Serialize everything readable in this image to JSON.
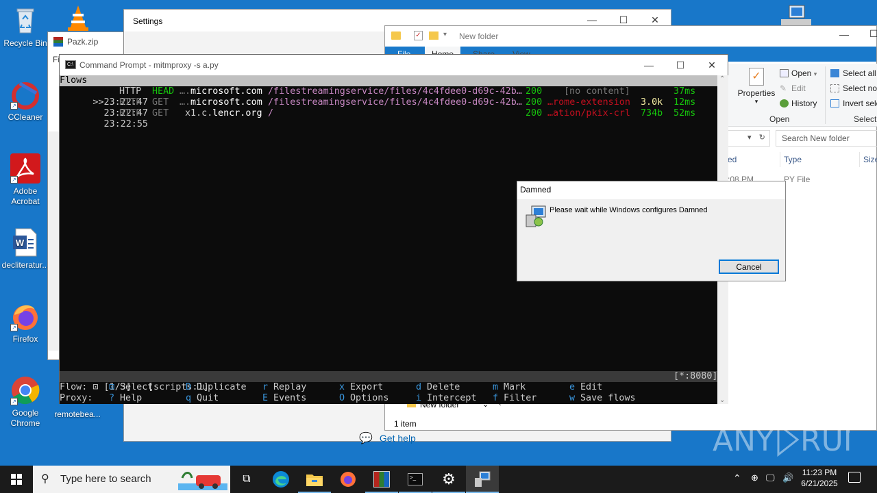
{
  "desktop": {
    "icons": [
      {
        "label": "Recycle Bin"
      },
      {
        "label": "CCleaner"
      },
      {
        "label": "Adobe Acrobat"
      },
      {
        "label": "decliteratur..."
      },
      {
        "label": "Firefox"
      },
      {
        "label": "Google Chrome"
      },
      {
        "label": "remotebea..."
      }
    ],
    "watermark": "ANY RUN"
  },
  "settings_window": {
    "title": "Settings",
    "get_help": "Get help"
  },
  "pazk_window": {
    "title": "Pazk.zip",
    "partial_menu": "Fi"
  },
  "explorer": {
    "title": "New folder",
    "tabs": [
      "File",
      "Home",
      "Share",
      "View"
    ],
    "ribbon": {
      "properties": "Properties",
      "open": "Open",
      "edit": "Edit",
      "history": "History",
      "open_group": "Open",
      "select_all": "Select all",
      "select_none": "Select nor",
      "invert_selection": "Invert sele",
      "select_group": "Select"
    },
    "search_placeholder": "Search New folder",
    "columns": {
      "modified": "ed",
      "type": "Type",
      "size": "Size"
    },
    "row": {
      "modified": ":08 PM",
      "type": "PY File"
    },
    "nav_folder": "New folder",
    "status": "1 item"
  },
  "cmd": {
    "title": "Command Prompt - mitmproxy  -s a.py",
    "header": "Flows",
    "flows": [
      {
        "marker": ">>",
        "time": "23:22:47",
        "proto": "HTTP",
        "method": "HEAD",
        "host_prefix": "….",
        "host": "microsoft.com",
        "path": "/filestreamingservice/files/4c4fdee0-d69c-42b…",
        "status": "200",
        "content": "[no content]",
        "size": "",
        "duration": "37ms"
      },
      {
        "marker": "  ",
        "time": "23:22:47",
        "proto": "HTTP",
        "method": "GET",
        "host_prefix": "….",
        "host": "microsoft.com",
        "path": "/filestreamingservice/files/4c4fdee0-d69c-42b…",
        "status": "200",
        "content": "…rome-extension",
        "size": "3.0k",
        "duration": "12ms"
      },
      {
        "marker": "  ",
        "time": "23:22:55",
        "proto": "HTTP",
        "method": "GET",
        "host_prefix": "x1.c.",
        "host": "lencr.org",
        "path": "/",
        "status": "200",
        "content": "…ation/pkix-crl",
        "size": "734b",
        "duration": "52ms"
      }
    ],
    "statusbar_left": "⊡ [1/3]   [scripts:1]",
    "statusbar_right": "[*:8080]",
    "keys_row1_label": "Flow:",
    "keys_row2_label": "Proxy:",
    "keys_row1": [
      {
        "key": "⊡",
        "label": "Select"
      },
      {
        "key": "D",
        "label": "Duplicate"
      },
      {
        "key": "r",
        "label": "Replay"
      },
      {
        "key": "x",
        "label": "Export"
      },
      {
        "key": "d",
        "label": "Delete"
      },
      {
        "key": "m",
        "label": "Mark"
      },
      {
        "key": "e",
        "label": "Edit"
      }
    ],
    "keys_row2": [
      {
        "key": "?",
        "label": "Help"
      },
      {
        "key": "q",
        "label": "Quit"
      },
      {
        "key": "E",
        "label": "Events"
      },
      {
        "key": "O",
        "label": "Options"
      },
      {
        "key": "i",
        "label": "Intercept"
      },
      {
        "key": "f",
        "label": "Filter"
      },
      {
        "key": "w",
        "label": "Save flows"
      }
    ]
  },
  "dialog": {
    "title": "Damned",
    "message": "Please wait while Windows configures Damned",
    "cancel": "Cancel"
  },
  "taskbar": {
    "search_placeholder": "Type here to search",
    "time": "11:23 PM",
    "date": "6/21/2025"
  },
  "colors": {
    "desktop": "#1877c9",
    "term_green": "#16c60c",
    "term_red": "#c50f1f",
    "term_gray": "#767676",
    "term_magenta": "#c586c0",
    "dialog_accent": "#0078d7"
  }
}
